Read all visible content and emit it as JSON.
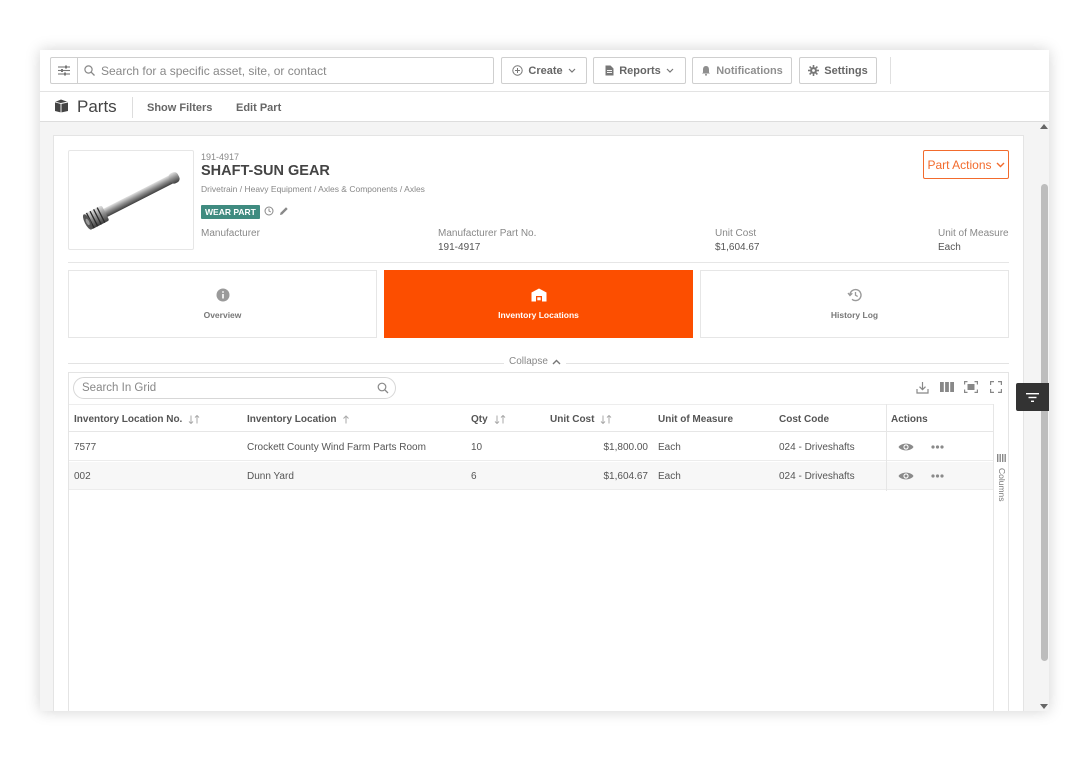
{
  "topbar": {
    "search_placeholder": "Search for a specific asset, site, or contact",
    "create_label": "Create",
    "reports_label": "Reports",
    "notifications_label": "Notifications",
    "settings_label": "Settings"
  },
  "page": {
    "title": "Parts",
    "show_filters": "Show Filters",
    "edit_part": "Edit Part"
  },
  "part": {
    "number": "191-4917",
    "name": "SHAFT-SUN GEAR",
    "path": "Drivetrain / Heavy Equipment / Axles & Components / Axles",
    "badge": "WEAR PART",
    "actions_label": "Part Actions",
    "attributes": [
      {
        "label": "Manufacturer",
        "value": ""
      },
      {
        "label": "Manufacturer Part No.",
        "value": "191-4917"
      },
      {
        "label": "Unit Cost",
        "value": "$1,604.67"
      },
      {
        "label": "Unit of Measure",
        "value": "Each"
      }
    ]
  },
  "tabs": [
    {
      "label": "Overview",
      "icon": "info-icon"
    },
    {
      "label": "Inventory Locations",
      "icon": "warehouse-icon"
    },
    {
      "label": "History Log",
      "icon": "history-icon"
    }
  ],
  "collapse_label": "Collapse",
  "grid": {
    "search_placeholder": "Search In Grid",
    "columns": [
      "Inventory Location No.",
      "Inventory Location",
      "Qty",
      "Unit Cost",
      "Unit of Measure",
      "Cost Code",
      "Actions"
    ],
    "rows": [
      {
        "loc_no": "7577",
        "location": "Crockett County Wind Farm Parts Room",
        "qty": "10",
        "unit_cost": "$1,800.00",
        "uom": "Each",
        "cost_code": "024 - Driveshafts"
      },
      {
        "loc_no": "002",
        "location": "Dunn Yard",
        "qty": "6",
        "unit_cost": "$1,604.67",
        "uom": "Each",
        "cost_code": "024 - Driveshafts"
      }
    ],
    "columns_panel_label": "Columns"
  },
  "colors": {
    "accent": "#fc4e00",
    "badge": "#3f8b80"
  }
}
